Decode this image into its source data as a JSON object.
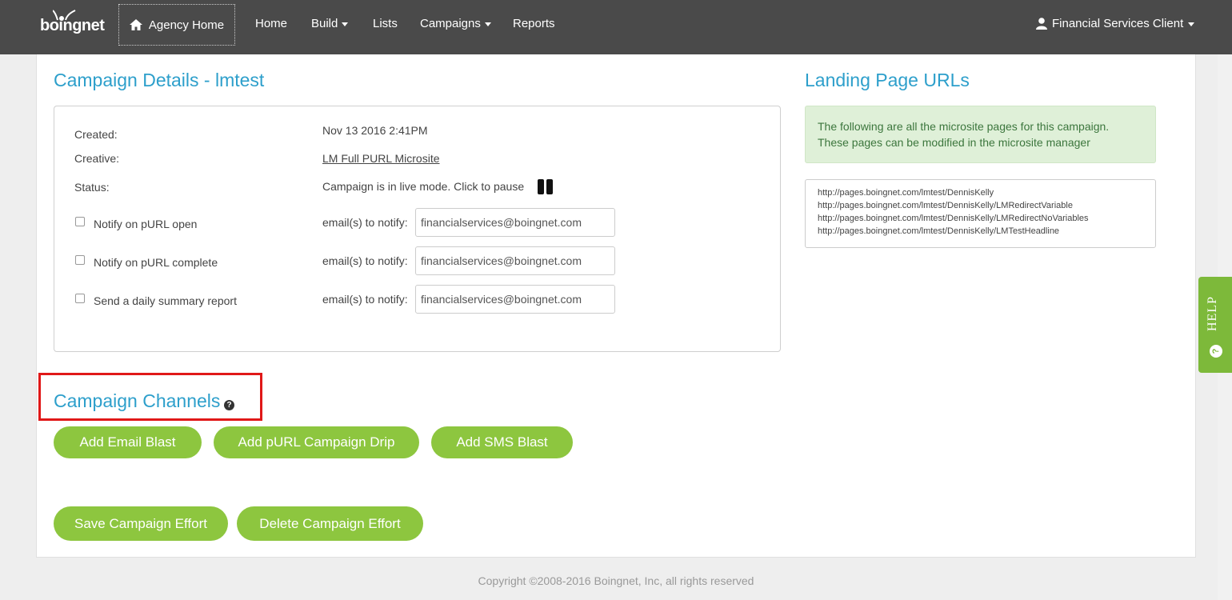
{
  "nav": {
    "logo_text": "boingnet",
    "agency_home": "Agency Home",
    "items": [
      {
        "label": "Home",
        "dropdown": false
      },
      {
        "label": "Build",
        "dropdown": true
      },
      {
        "label": "Lists",
        "dropdown": false
      },
      {
        "label": "Campaigns",
        "dropdown": true
      },
      {
        "label": "Reports",
        "dropdown": false
      }
    ],
    "user": "Financial Services Client"
  },
  "details": {
    "title": "Campaign Details - lmtest",
    "created_label": "Created:",
    "created_value": "Nov 13 2016 2:41PM",
    "creative_label": "Creative:",
    "creative_value": "LM Full PURL Microsite",
    "status_label": "Status:",
    "status_value": "Campaign is in live mode. Click to pause",
    "notify_rows": [
      {
        "label": "Notify on pURL open",
        "email_label": "email(s) to notify:",
        "email": "financialservices@boingnet.com",
        "checked": false
      },
      {
        "label": "Notify on pURL complete",
        "email_label": "email(s) to notify:",
        "email": "financialservices@boingnet.com",
        "checked": false
      },
      {
        "label": "Send a daily summary report",
        "email_label": "email(s) to notify:",
        "email": "financialservices@boingnet.com",
        "checked": false
      }
    ]
  },
  "landing": {
    "title": "Landing Page URLs",
    "info_line1": "The following are all the microsite pages for this campaign.",
    "info_line2": "These pages can be modified in the microsite manager",
    "urls": [
      "http://pages.boingnet.com/lmtest/DennisKelly",
      "http://pages.boingnet.com/lmtest/DennisKelly/LMRedirectVariable",
      "http://pages.boingnet.com/lmtest/DennisKelly/LMRedirectNoVariables",
      "http://pages.boingnet.com/lmtest/DennisKelly/LMTestHeadline"
    ]
  },
  "channels": {
    "title": "Campaign Channels",
    "help_glyph": "?",
    "buttons": [
      "Add Email Blast",
      "Add pURL Campaign Drip",
      "Add SMS Blast"
    ]
  },
  "actions": {
    "save": "Save Campaign Effort",
    "delete": "Delete Campaign Effort"
  },
  "help_tab": {
    "label": "HELP",
    "glyph": "?"
  },
  "footer": "Copyright ©2008-2016 Boingnet, Inc, all rights reserved",
  "colors": {
    "nav_bg": "#4a4a4a",
    "title_blue": "#2d9fcb",
    "button_green": "#8dc63f",
    "info_bg": "#dff0d8",
    "highlight_red": "#e01818"
  }
}
